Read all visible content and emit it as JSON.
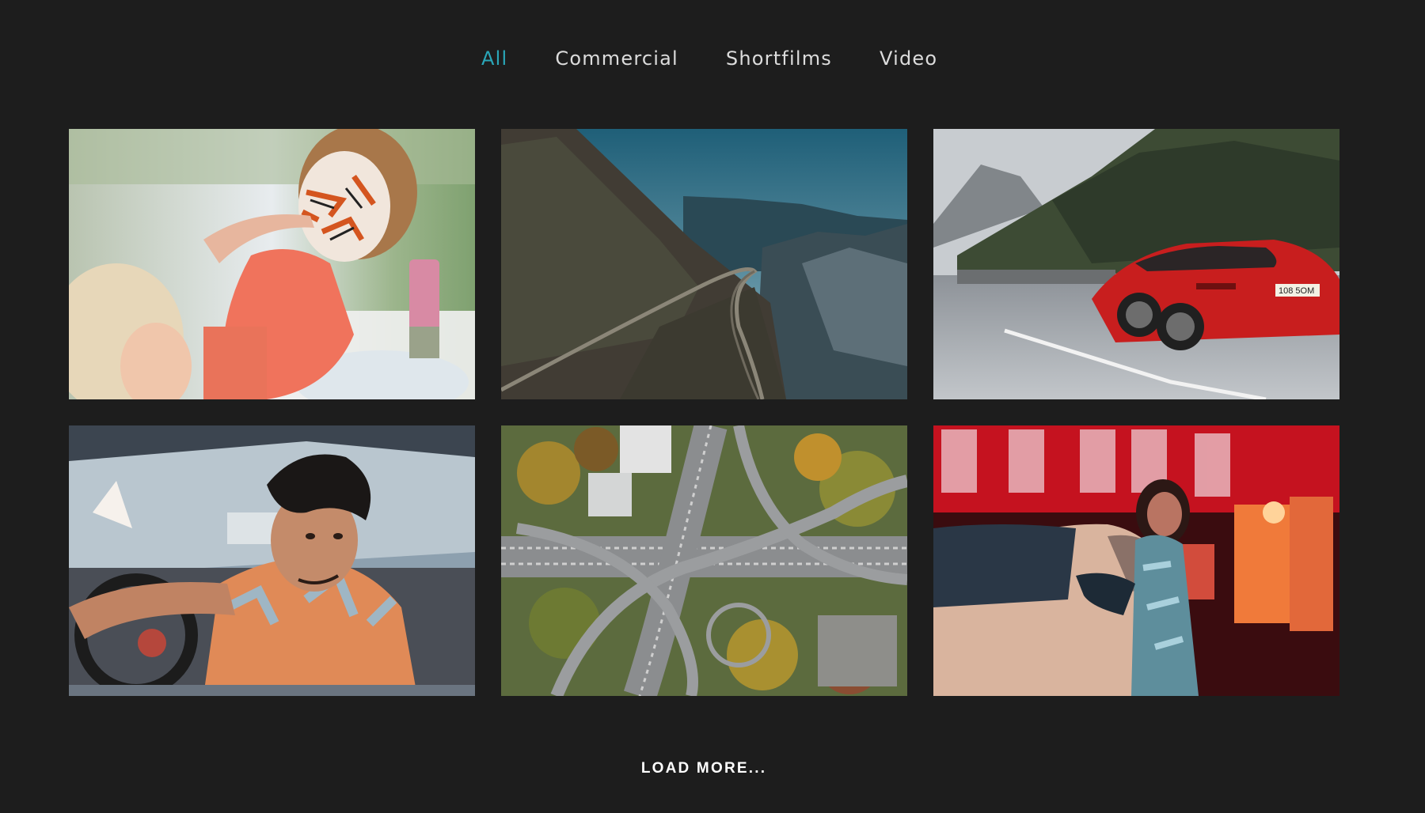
{
  "filters": {
    "tabs": [
      {
        "label": "All",
        "active": true
      },
      {
        "label": "Commercial",
        "active": false
      },
      {
        "label": "Shortfilms",
        "active": false
      },
      {
        "label": "Video",
        "active": false
      }
    ],
    "accent_color": "#2aa6b8"
  },
  "gallery": {
    "items": [
      {
        "subject": "face-paint-child"
      },
      {
        "subject": "mountain-road"
      },
      {
        "subject": "red-sports-car"
      },
      {
        "subject": "man-in-car"
      },
      {
        "subject": "highway-interchange"
      },
      {
        "subject": "woman-red-building"
      }
    ],
    "plate_text": "108 5OM"
  },
  "load_more": {
    "label": "LOAD MORE..."
  }
}
